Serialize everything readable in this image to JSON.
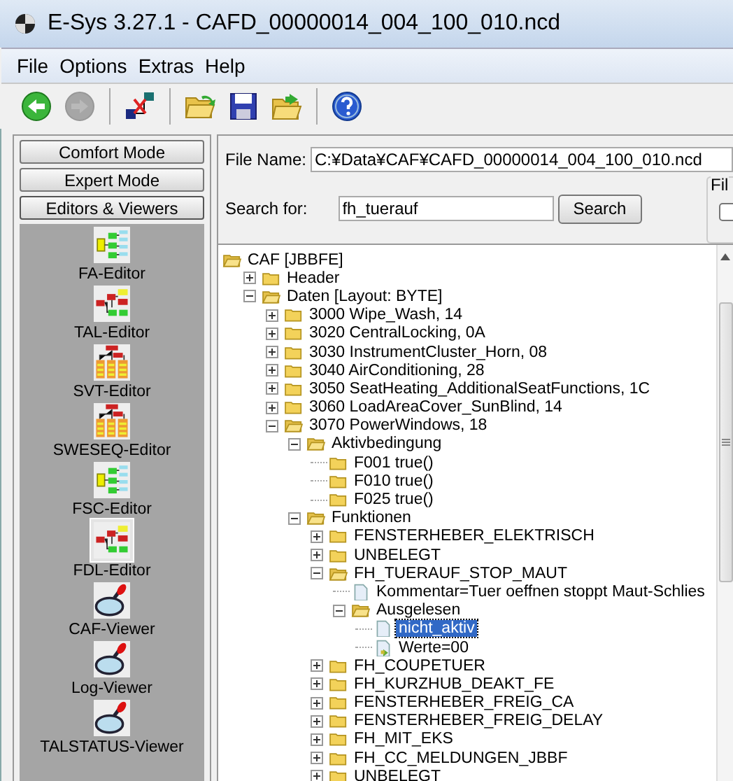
{
  "window": {
    "title": "E-Sys 3.27.1 - CAFD_00000014_004_100_010.ncd"
  },
  "menu": [
    "File",
    "Options",
    "Extras",
    "Help"
  ],
  "toolbar": [
    {
      "kind": "back",
      "disabled": false
    },
    {
      "kind": "forward",
      "disabled": true
    },
    {
      "kind": "sep"
    },
    {
      "kind": "connect",
      "disabled": false
    },
    {
      "kind": "sep"
    },
    {
      "kind": "open",
      "disabled": false
    },
    {
      "kind": "save",
      "disabled": false
    },
    {
      "kind": "folder-arrow",
      "disabled": false
    },
    {
      "kind": "sep"
    },
    {
      "kind": "help",
      "disabled": false
    }
  ],
  "sidebar": {
    "mode_buttons": [
      {
        "label": "Comfort Mode",
        "selected": false
      },
      {
        "label": "Expert Mode",
        "selected": false
      },
      {
        "label": "Editors & Viewers",
        "selected": true
      }
    ],
    "items": [
      {
        "label": "FA-Editor",
        "kind": "tree-yellow",
        "selected": false
      },
      {
        "label": "TAL-Editor",
        "kind": "tree-red",
        "selected": false
      },
      {
        "label": "SVT-Editor",
        "kind": "hierarchy",
        "selected": false
      },
      {
        "label": "SWESEQ-Editor",
        "kind": "hierarchy",
        "selected": false
      },
      {
        "label": "FSC-Editor",
        "kind": "tree-yellow",
        "selected": false
      },
      {
        "label": "FDL-Editor",
        "kind": "tree-red",
        "selected": true
      },
      {
        "label": "CAF-Viewer",
        "kind": "magnifier",
        "selected": false
      },
      {
        "label": "Log-Viewer",
        "kind": "magnifier",
        "selected": false
      },
      {
        "label": "TALSTATUS-Viewer",
        "kind": "magnifier",
        "selected": false
      }
    ]
  },
  "file_name": {
    "label": "File Name:",
    "value": "C:¥Data¥CAF¥CAFD_00000014_004_100_010.ncd"
  },
  "search": {
    "label": "Search for:",
    "value": "fh_tuerauf",
    "button": "Search"
  },
  "filter_group": {
    "label": "Fil",
    "checked": false
  },
  "tree": [
    {
      "label": "CAF [JBBFE]",
      "kind": "folder",
      "open": true,
      "children": [
        {
          "label": "Header",
          "kind": "folder",
          "expanded": false
        },
        {
          "label": "Daten [Layout: BYTE]",
          "kind": "folder",
          "expanded": true,
          "children": [
            {
              "label": "3000 Wipe_Wash, 14",
              "kind": "folder",
              "expanded": false
            },
            {
              "label": "3020 CentralLocking, 0A",
              "kind": "folder",
              "expanded": false
            },
            {
              "label": "3030 InstrumentCluster_Horn, 08",
              "kind": "folder",
              "expanded": false
            },
            {
              "label": "3040 AirConditioning, 28",
              "kind": "folder",
              "expanded": false
            },
            {
              "label": "3050 SeatHeating_AdditionalSeatFunctions, 1C",
              "kind": "folder",
              "expanded": false
            },
            {
              "label": "3060 LoadAreaCover_SunBlind, 14",
              "kind": "folder",
              "expanded": false
            },
            {
              "label": "3070 PowerWindows, 18",
              "kind": "folder",
              "expanded": true,
              "children": [
                {
                  "label": "Aktivbedingung",
                  "kind": "folder",
                  "expanded": true,
                  "children": [
                    {
                      "label": "F001 true()",
                      "kind": "folder"
                    },
                    {
                      "label": "F010 true()",
                      "kind": "folder"
                    },
                    {
                      "label": "F025 true()",
                      "kind": "folder"
                    }
                  ]
                },
                {
                  "label": "Funktionen",
                  "kind": "folder",
                  "expanded": true,
                  "children": [
                    {
                      "label": "FENSTERHEBER_ELEKTRISCH",
                      "kind": "folder",
                      "expanded": false
                    },
                    {
                      "label": "UNBELEGT",
                      "kind": "folder",
                      "expanded": false
                    },
                    {
                      "label": "FH_TUERAUF_STOP_MAUT",
                      "kind": "folder",
                      "expanded": true,
                      "children": [
                        {
                          "label": "Kommentar=Tuer oeffnen stoppt Maut-Schlies",
                          "kind": "file"
                        },
                        {
                          "label": "Ausgelesen",
                          "kind": "folder",
                          "expanded": true,
                          "children": [
                            {
                              "label": "nicht_aktiv",
                              "kind": "file",
                              "selected": true
                            },
                            {
                              "label": "Werte=00",
                              "kind": "value",
                              "selected": false
                            }
                          ]
                        }
                      ]
                    },
                    {
                      "label": "FH_COUPETUER",
                      "kind": "folder",
                      "expanded": false
                    },
                    {
                      "label": "FH_KURZHUB_DEAKT_FE",
                      "kind": "folder",
                      "expanded": false
                    },
                    {
                      "label": "FENSTERHEBER_FREIG_CA",
                      "kind": "folder",
                      "expanded": false
                    },
                    {
                      "label": "FENSTERHEBER_FREIG_DELAY",
                      "kind": "folder",
                      "expanded": false
                    },
                    {
                      "label": "FH_MIT_EKS",
                      "kind": "folder",
                      "expanded": false
                    },
                    {
                      "label": "FH_CC_MELDUNGEN_JBBF",
                      "kind": "folder",
                      "expanded": false
                    },
                    {
                      "label": "UNBELEGT",
                      "kind": "folder",
                      "expanded": false
                    }
                  ]
                }
              ]
            }
          ]
        }
      ]
    }
  ]
}
